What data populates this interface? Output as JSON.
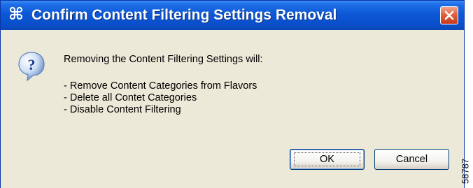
{
  "dialog": {
    "title": "Confirm Content Filtering Settings Removal",
    "title_icon": "⌘",
    "message_heading": "Removing the Content Filtering Settings will:",
    "bullets": [
      "- Remove Content Categories from Flavors",
      "- Delete all Contet Categories",
      "- Disable Content Filtering"
    ]
  },
  "buttons": {
    "ok_label": "OK",
    "cancel_label": "Cancel"
  },
  "figure_number": "58787",
  "icons": {
    "title": "command-key-icon",
    "close": "close-icon",
    "message": "question-icon"
  }
}
